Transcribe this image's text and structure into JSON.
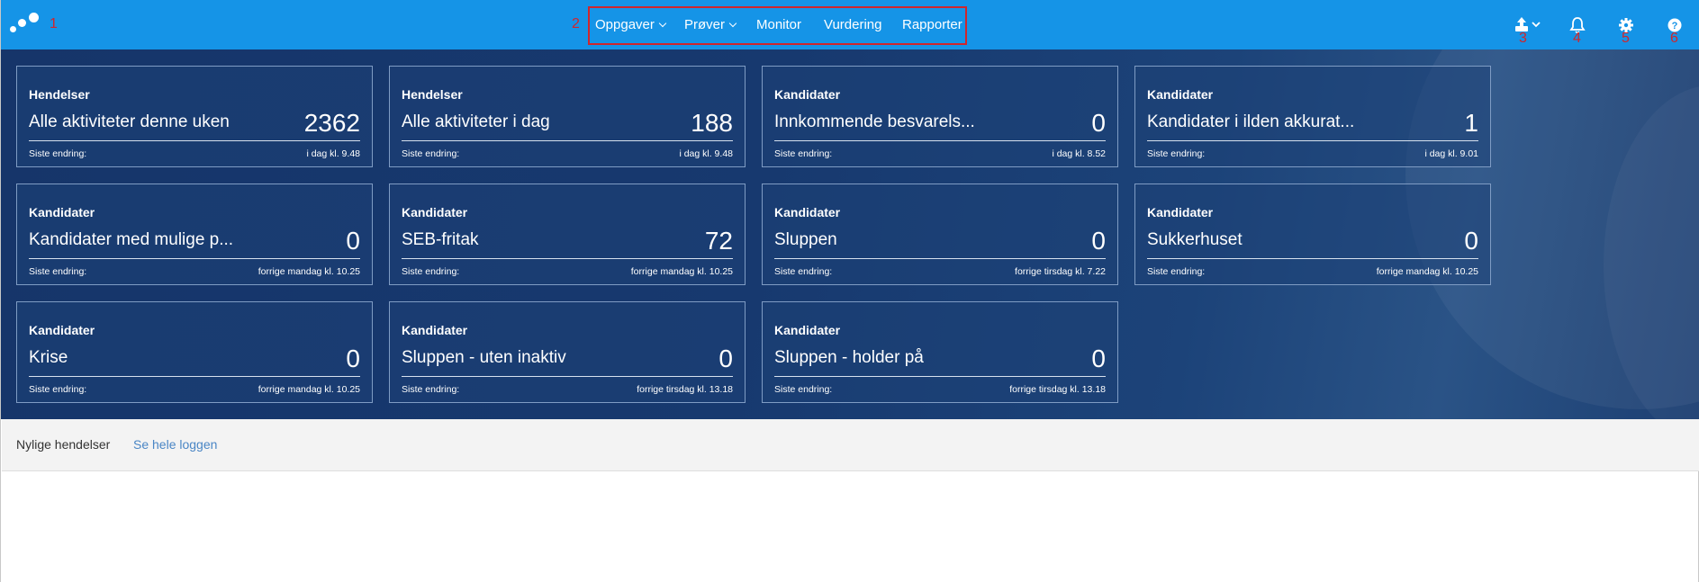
{
  "annotations": [
    "1",
    "2",
    "3",
    "4",
    "5",
    "6"
  ],
  "nav": {
    "items": [
      {
        "label": "Oppgaver",
        "dropdown": true
      },
      {
        "label": "Prøver",
        "dropdown": true
      },
      {
        "label": "Monitor",
        "dropdown": false
      },
      {
        "label": "Vurdering",
        "dropdown": false
      },
      {
        "label": "Rapporter",
        "dropdown": false
      }
    ]
  },
  "toolbar_icons": [
    "upload-icon",
    "bell-icon",
    "gear-icon",
    "help-icon"
  ],
  "colors": {
    "topbar": "#1594e7",
    "dashboard": "#17396f",
    "annotation": "#d0262c",
    "link": "#4a86c5"
  },
  "cards": [
    {
      "category": "Hendelser",
      "title": "Alle aktiviteter denne uken",
      "value": "2362",
      "footer_label": "Siste endring:",
      "footer_time": "i dag kl. 9.48"
    },
    {
      "category": "Hendelser",
      "title": "Alle aktiviteter i dag",
      "value": "188",
      "footer_label": "Siste endring:",
      "footer_time": "i dag kl. 9.48"
    },
    {
      "category": "Kandidater",
      "title": "Innkommende besvarels...",
      "value": "0",
      "footer_label": "Siste endring:",
      "footer_time": "i dag kl. 8.52"
    },
    {
      "category": "Kandidater",
      "title": "Kandidater i ilden akkurat...",
      "value": "1",
      "footer_label": "Siste endring:",
      "footer_time": "i dag kl. 9.01"
    },
    {
      "category": "Kandidater",
      "title": "Kandidater med mulige p...",
      "value": "0",
      "footer_label": "Siste endring:",
      "footer_time": "forrige mandag kl. 10.25"
    },
    {
      "category": "Kandidater",
      "title": "SEB-fritak",
      "value": "72",
      "footer_label": "Siste endring:",
      "footer_time": "forrige mandag kl. 10.25"
    },
    {
      "category": "Kandidater",
      "title": "Sluppen",
      "value": "0",
      "footer_label": "Siste endring:",
      "footer_time": "forrige tirsdag kl. 7.22"
    },
    {
      "category": "Kandidater",
      "title": "Sukkerhuset",
      "value": "0",
      "footer_label": "Siste endring:",
      "footer_time": "forrige mandag kl. 10.25"
    },
    {
      "category": "Kandidater",
      "title": "Krise",
      "value": "0",
      "footer_label": "Siste endring:",
      "footer_time": "forrige mandag kl. 10.25"
    },
    {
      "category": "Kandidater",
      "title": "Sluppen - uten inaktiv",
      "value": "0",
      "footer_label": "Siste endring:",
      "footer_time": "forrige tirsdag kl. 13.18"
    },
    {
      "category": "Kandidater",
      "title": "Sluppen - holder på",
      "value": "0",
      "footer_label": "Siste endring:",
      "footer_time": "forrige tirsdag kl. 13.18"
    }
  ],
  "recent": {
    "label": "Nylige hendelser",
    "link": "Se hele loggen"
  }
}
